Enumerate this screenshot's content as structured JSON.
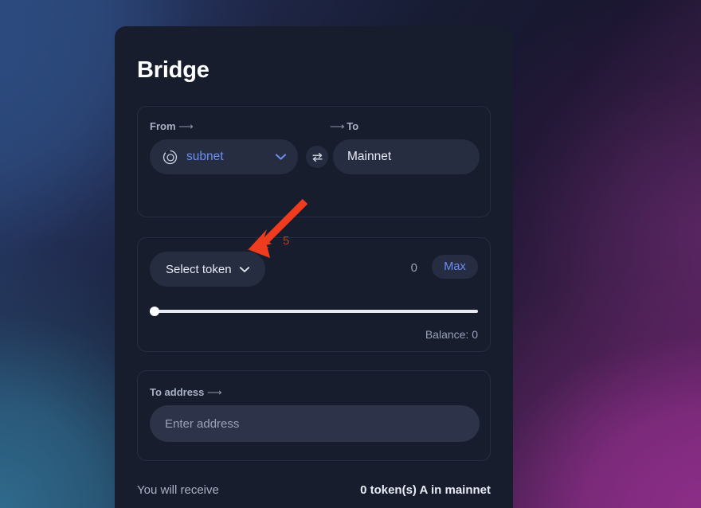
{
  "page": {
    "title": "Bridge"
  },
  "from_to": {
    "from_label": "From",
    "from_arrow": "⟶",
    "to_label": "To",
    "to_arrow": "⟶",
    "from_network": "subnet",
    "from_network_icon": "subnet-logo-icon",
    "to_network": "Mainnet",
    "swap_icon": "swap-arrows-icon",
    "chevron_icon": "chevron-down-icon"
  },
  "token": {
    "select_label": "Select token",
    "chevron_icon": "chevron-down-icon",
    "amount_value": "0",
    "max_label": "Max",
    "slider_percent": 0,
    "balance_label": "Balance: 0"
  },
  "address": {
    "label": "To address",
    "arrow": "⟶",
    "placeholder": "Enter address",
    "value": ""
  },
  "receive": {
    "label": "You will receive",
    "value": "0 token(s) A in mainnet"
  },
  "annotation": {
    "step_number": "5",
    "arrow_color": "#ef3c1e",
    "text_color": "#cf3322",
    "points_to": "select-token-button"
  },
  "colors": {
    "accent_blue": "#6b8ef5",
    "card_bg": "#181d2e",
    "pill_bg": "#272d41",
    "input_bg": "#2d3348",
    "panel_border": "#262c43",
    "muted_text": "#9aa2b8"
  }
}
